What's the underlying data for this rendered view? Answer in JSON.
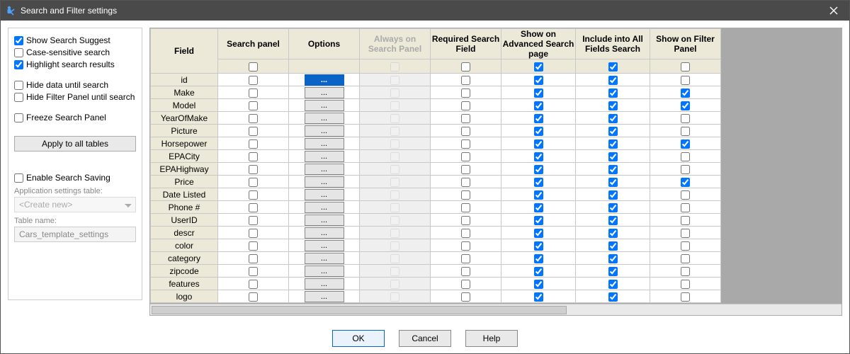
{
  "window": {
    "title": "Search and Filter settings"
  },
  "left": {
    "show_suggest": "Show Search Suggest",
    "case_sensitive": "Case-sensitive search",
    "highlight": "Highlight search results",
    "hide_data": "Hide data until search",
    "hide_filter": "Hide Filter Panel until search",
    "freeze": "Freeze Search Panel",
    "apply": "Apply to all tables",
    "enable_saving": "Enable Search Saving",
    "app_settings_label": "Application settings table:",
    "app_settings_value": "<Create new>",
    "table_name_label": "Table name:",
    "table_name_value": "Cars_template_settings",
    "chk": {
      "show_suggest": true,
      "case_sensitive": false,
      "highlight": true,
      "hide_data": false,
      "hide_filter": false,
      "freeze": false,
      "enable_saving": false
    }
  },
  "grid": {
    "headers": {
      "field": "Field",
      "search_panel": "Search panel",
      "options": "Options",
      "always": "Always on Search Panel",
      "required": "Required Search Field",
      "advanced": "Show on Advanced Search page",
      "allfields": "Include into All Fields Search",
      "filter": "Show on Filter Panel"
    },
    "header_checks": {
      "search_panel": false,
      "always": false,
      "required": false,
      "advanced": true,
      "allfields": true,
      "filter": false
    },
    "options_label": "...",
    "rows": [
      {
        "name": "id",
        "sp": false,
        "opt_sel": true,
        "always": false,
        "req": false,
        "adv": true,
        "all": true,
        "filter": false
      },
      {
        "name": "Make",
        "sp": false,
        "opt_sel": false,
        "always": false,
        "req": false,
        "adv": true,
        "all": true,
        "filter": true
      },
      {
        "name": "Model",
        "sp": false,
        "opt_sel": false,
        "always": false,
        "req": false,
        "adv": true,
        "all": true,
        "filter": true
      },
      {
        "name": "YearOfMake",
        "sp": false,
        "opt_sel": false,
        "always": false,
        "req": false,
        "adv": true,
        "all": true,
        "filter": false
      },
      {
        "name": "Picture",
        "sp": false,
        "opt_sel": false,
        "always": false,
        "req": false,
        "adv": true,
        "all": true,
        "filter": false
      },
      {
        "name": "Horsepower",
        "sp": false,
        "opt_sel": false,
        "always": false,
        "req": false,
        "adv": true,
        "all": true,
        "filter": true
      },
      {
        "name": "EPACity",
        "sp": false,
        "opt_sel": false,
        "always": false,
        "req": false,
        "adv": true,
        "all": true,
        "filter": false
      },
      {
        "name": "EPAHighway",
        "sp": false,
        "opt_sel": false,
        "always": false,
        "req": false,
        "adv": true,
        "all": true,
        "filter": false
      },
      {
        "name": "Price",
        "sp": false,
        "opt_sel": false,
        "always": false,
        "req": false,
        "adv": true,
        "all": true,
        "filter": true
      },
      {
        "name": "Date Listed",
        "sp": false,
        "opt_sel": false,
        "always": false,
        "req": false,
        "adv": true,
        "all": true,
        "filter": false
      },
      {
        "name": "Phone #",
        "sp": false,
        "opt_sel": false,
        "always": false,
        "req": false,
        "adv": true,
        "all": true,
        "filter": false
      },
      {
        "name": "UserID",
        "sp": false,
        "opt_sel": false,
        "always": false,
        "req": false,
        "adv": true,
        "all": true,
        "filter": false
      },
      {
        "name": "descr",
        "sp": false,
        "opt_sel": false,
        "always": false,
        "req": false,
        "adv": true,
        "all": true,
        "filter": false
      },
      {
        "name": "color",
        "sp": false,
        "opt_sel": false,
        "always": false,
        "req": false,
        "adv": true,
        "all": true,
        "filter": false
      },
      {
        "name": "category",
        "sp": false,
        "opt_sel": false,
        "always": false,
        "req": false,
        "adv": true,
        "all": true,
        "filter": false
      },
      {
        "name": "zipcode",
        "sp": false,
        "opt_sel": false,
        "always": false,
        "req": false,
        "adv": true,
        "all": true,
        "filter": false
      },
      {
        "name": "features",
        "sp": false,
        "opt_sel": false,
        "always": false,
        "req": false,
        "adv": true,
        "all": true,
        "filter": false
      },
      {
        "name": "logo",
        "sp": false,
        "opt_sel": false,
        "always": false,
        "req": false,
        "adv": true,
        "all": true,
        "filter": false
      }
    ]
  },
  "footer": {
    "ok": "OK",
    "cancel": "Cancel",
    "help": "Help"
  }
}
